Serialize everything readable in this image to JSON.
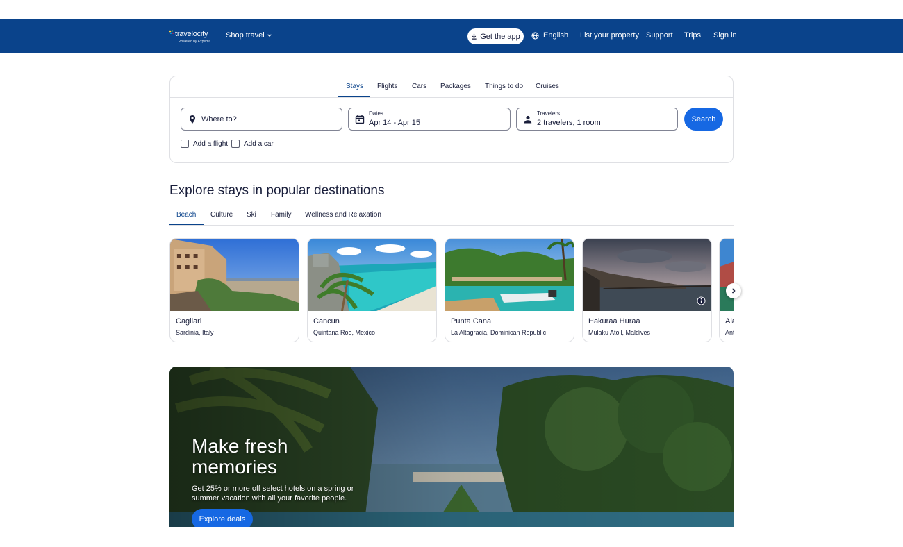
{
  "header": {
    "logo_text": "travelocity",
    "logo_sub": "Powered by Expedia",
    "shop_travel": "Shop travel",
    "get_app": "Get the app",
    "language": "English",
    "list_property": "List your property",
    "support": "Support",
    "trips": "Trips",
    "sign_in": "Sign in",
    "bg_color": "#0a438b"
  },
  "search": {
    "tabs": [
      "Stays",
      "Flights",
      "Cars",
      "Packages",
      "Things to do",
      "Cruises"
    ],
    "active_tab": "Stays",
    "where_placeholder": "Where to?",
    "dates_label": "Dates",
    "dates_value": "Apr 14 - Apr 15",
    "travelers_label": "Travelers",
    "travelers_value": "2 travelers, 1 room",
    "search_button": "Search",
    "add_flight": "Add a flight",
    "add_car": "Add a car"
  },
  "explore": {
    "title": "Explore stays in popular destinations",
    "categories": [
      "Beach",
      "Culture",
      "Ski",
      "Family",
      "Wellness and Relaxation"
    ],
    "active_category": "Beach",
    "destinations": [
      {
        "name": "Cagliari",
        "location": "Sardinia, Italy"
      },
      {
        "name": "Cancun",
        "location": "Quintana Roo, Mexico"
      },
      {
        "name": "Punta Cana",
        "location": "La Altagracia, Dominican Republic"
      },
      {
        "name": "Hakuraa Huraa",
        "location": "Mulaku Atoll, Maldives"
      },
      {
        "name": "Ala",
        "location": "Ant"
      }
    ]
  },
  "banner": {
    "headline": "Make fresh memories",
    "subtext": "Get 25% or more off select hotels on a spring or summer vacation with all your favorite people.",
    "cta": "Explore deals"
  },
  "icons": {
    "download": "download-icon",
    "globe": "globe-icon",
    "pin": "map-pin-icon",
    "calendar": "calendar-icon",
    "person": "person-icon",
    "chevron": "chevron-right-icon",
    "info": "info-icon"
  },
  "colors": {
    "accent": "#1668e3",
    "brand": "#0a438b",
    "text": "#191e3b"
  }
}
